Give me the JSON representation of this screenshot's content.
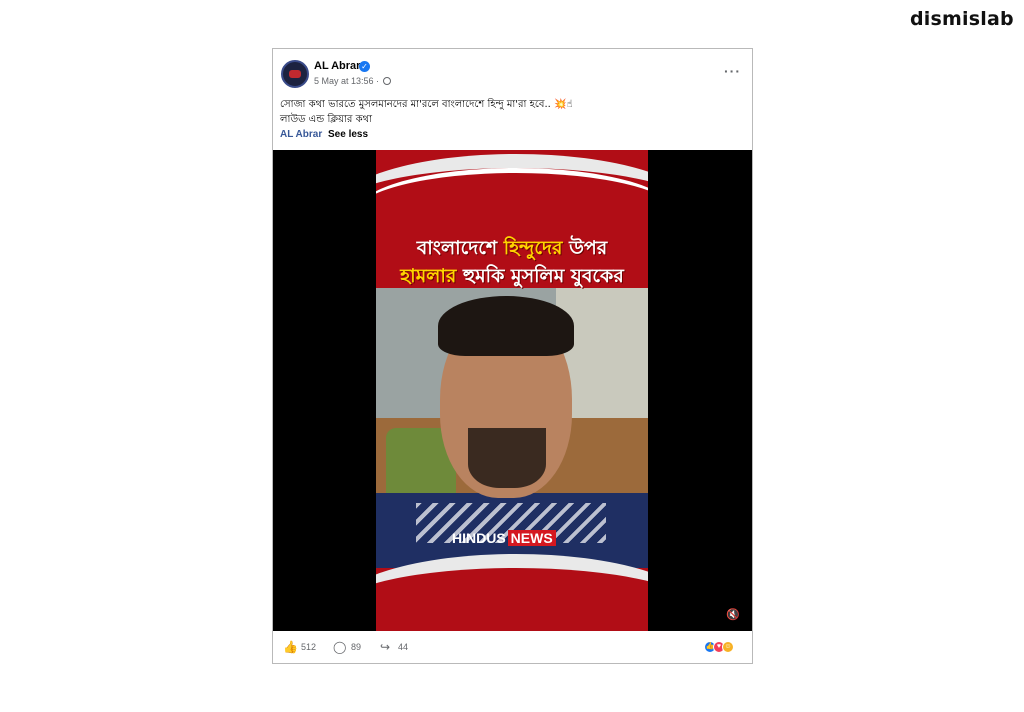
{
  "brand": {
    "logo_text": "dismislab"
  },
  "post": {
    "page_name": "AL Abrar",
    "time": "5 May at 13:56 ·",
    "caption_line1": "সোজা কথা ভারতে মুসলমানদের মা'রলে বাংলাদেশে হিন্দু মা'রা হবে.. 💥☝",
    "caption_line2": "লাউড এন্ড ক্লিয়ার কথা",
    "caption_author": "AL Abrar",
    "see_less": "See less",
    "video": {
      "headline_line1_white": "বাংলাদেশে ",
      "headline_line1_yellow": "হিন্দুদের",
      "headline_line1_tail": " উপর",
      "headline_line2_yellow": "হামলার",
      "headline_line2_white": " হুমকি মুসলিম যুবকের",
      "watermark_left": "HINDUS",
      "watermark_right": "NEWS"
    },
    "footer": {
      "likes": "512",
      "comments": "89",
      "shares": "44"
    }
  },
  "icons": {
    "verified": "verified-badge-icon",
    "globe": "globe-icon",
    "more": "more-options-icon",
    "like": "thumbs-up-icon",
    "comment": "comment-bubble-icon",
    "share": "share-arrow-icon",
    "mute": "speaker-muted-icon"
  },
  "colors": {
    "accent": "#1877f2",
    "thumbnail_red": "#b10d16",
    "highlight_yellow": "#ffd400"
  }
}
